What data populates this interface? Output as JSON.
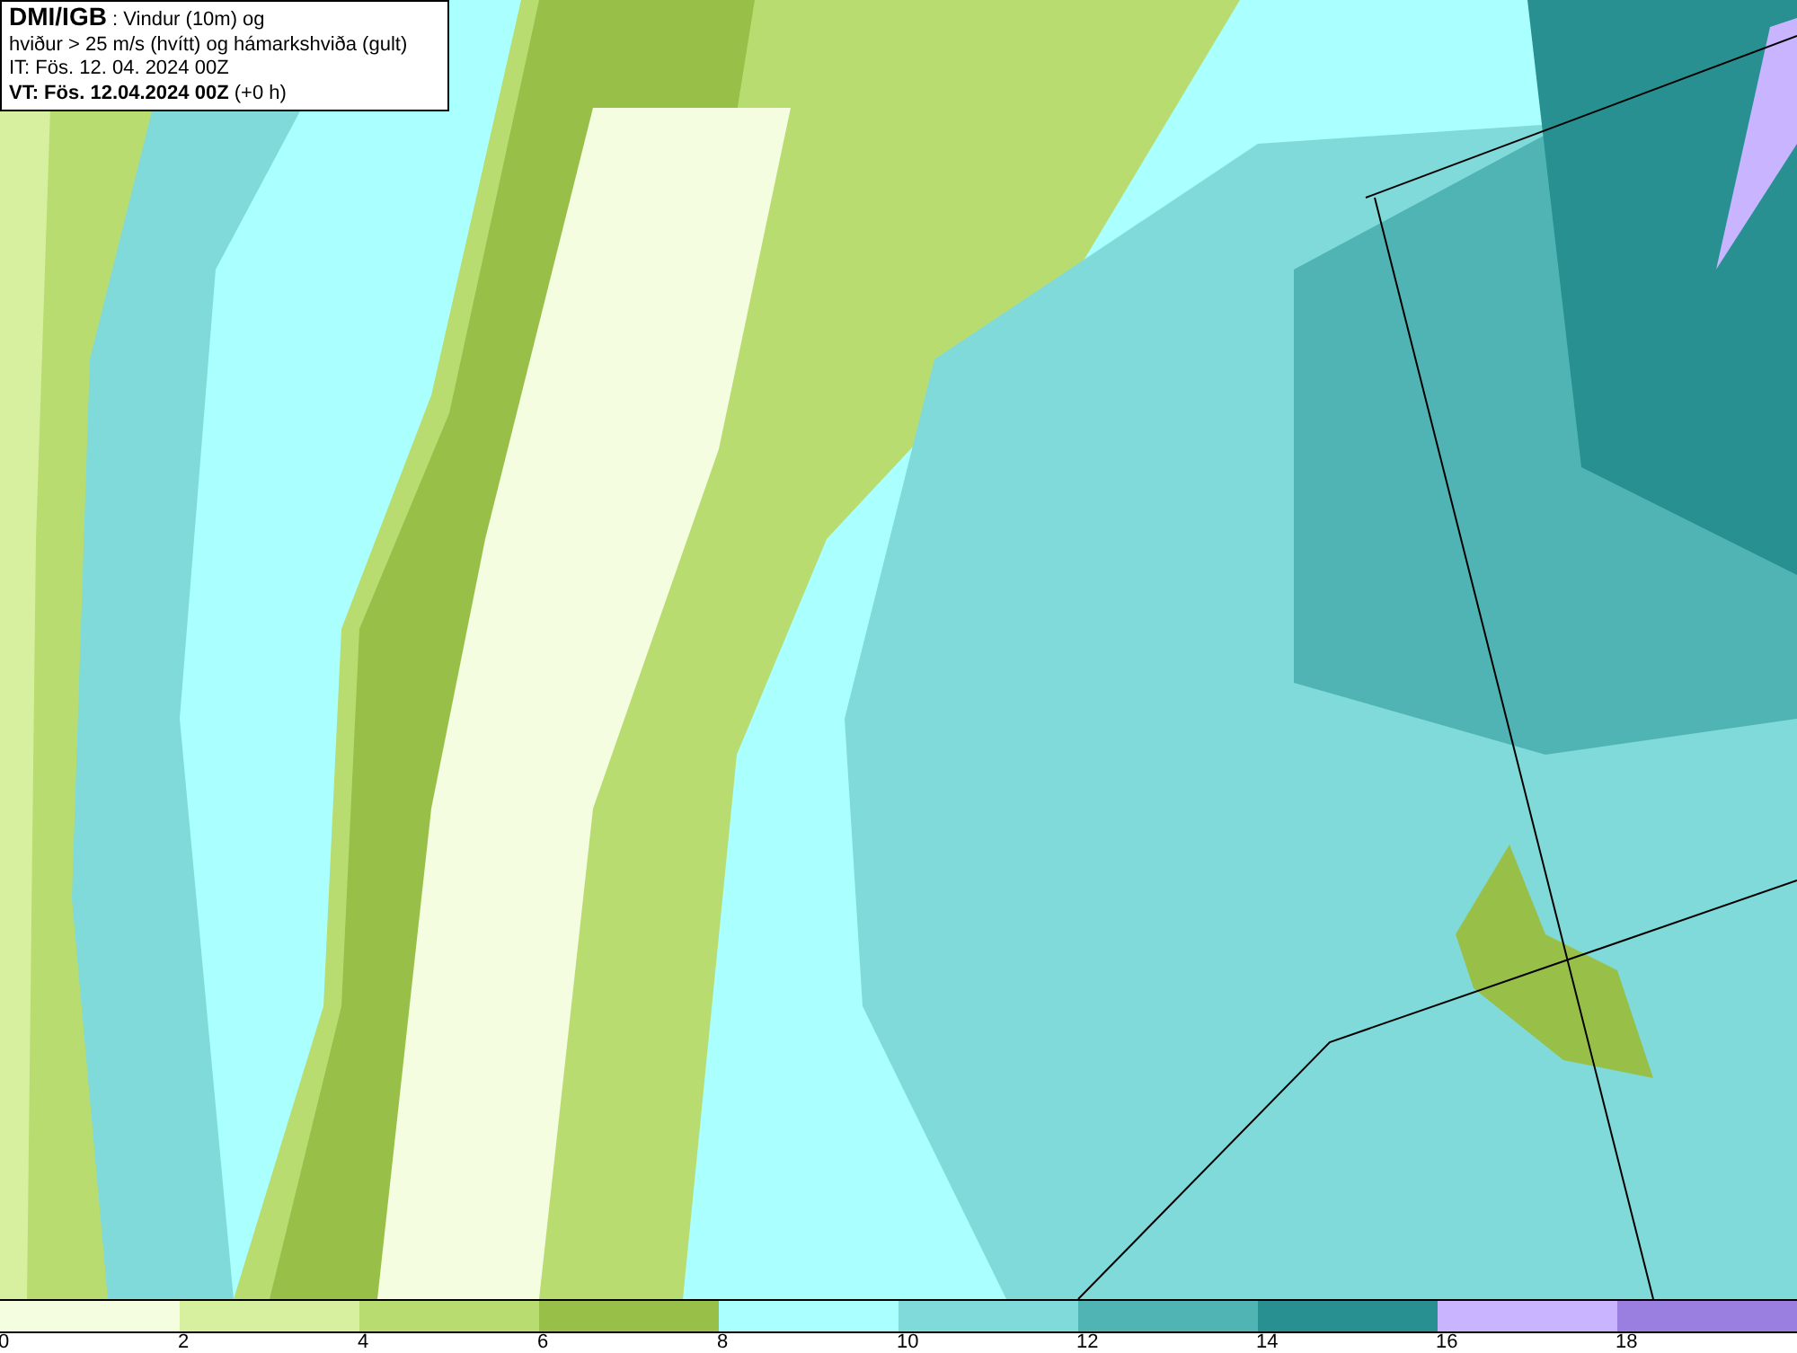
{
  "info_box": {
    "lines": [
      "**DMI/IGB** : Vindur (10m) og",
      "hviður > 25 m/s (hvítt) og hámarkshviða (gult)",
      "IT: Fös. 12. 04. 2024 00Z",
      "**VT: Fös. 12.04.2024 00Z** (+0 h)"
    ]
  },
  "legend": {
    "bins": [
      {
        "color": "#f4fde0"
      },
      {
        "color": "#d7f0a0"
      },
      {
        "color": "#b8dc70"
      },
      {
        "color": "#98c048"
      },
      {
        "color": "#aaffff"
      },
      {
        "color": "#80dada"
      },
      {
        "color": "#50b4b4"
      },
      {
        "color": "#289090"
      },
      {
        "color": "#c8b4ff"
      },
      {
        "color": "#9a7ee0"
      }
    ],
    "ticks": [
      "0",
      "2",
      "4",
      "6",
      "8",
      "10",
      "12",
      "14",
      "16",
      "18"
    ]
  }
}
